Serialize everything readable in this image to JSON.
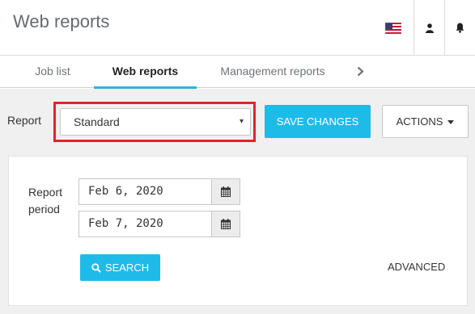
{
  "header": {
    "title": "Web reports",
    "flag_icon": "us-flag-icon",
    "user_icon": "user-icon",
    "bell_icon": "bell-icon"
  },
  "tabs": [
    {
      "label": "Job list",
      "active": false
    },
    {
      "label": "Web reports",
      "active": true
    },
    {
      "label": "Management reports",
      "active": false
    }
  ],
  "tabs_next_icon": "chevron-right-icon",
  "report": {
    "label": "Report",
    "selected": "Standard",
    "caret": "▾"
  },
  "buttons": {
    "save": "SAVE CHANGES",
    "actions": "ACTIONS",
    "search": "SEARCH",
    "advanced": "ADVANCED"
  },
  "period": {
    "label_line1": "Report",
    "label_line2": "period",
    "from": "Feb 6, 2020",
    "to": "Feb 7, 2020"
  },
  "colors": {
    "accent": "#1ebbe9",
    "highlight_border": "#e3232c",
    "tab_underline": "#2bb5e0"
  }
}
